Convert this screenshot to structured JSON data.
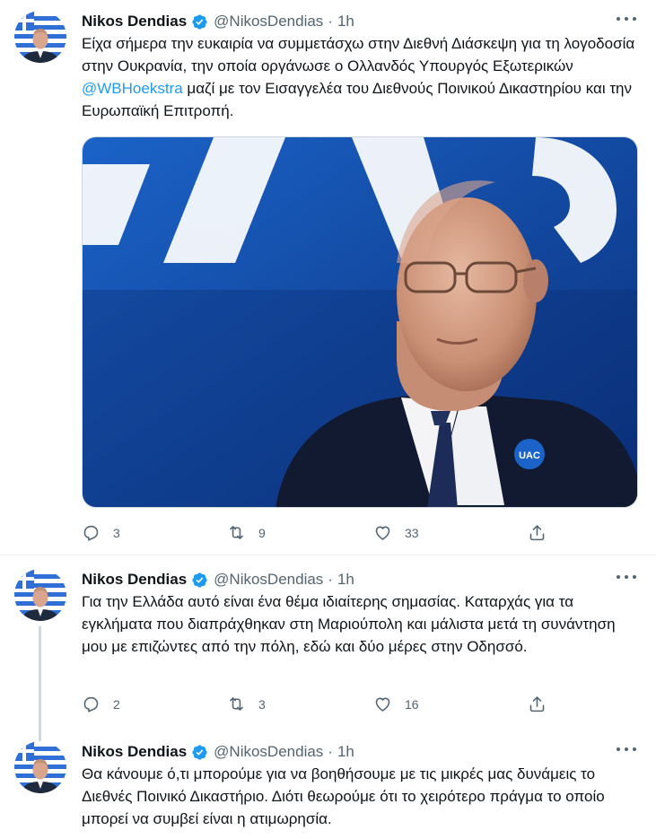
{
  "colors": {
    "accent": "#1d9bf0",
    "secondary": "#536471",
    "text": "#0f1419"
  },
  "tweets": [
    {
      "name": "Nikos Dendias",
      "handle": "@NikosDendias",
      "dot": "·",
      "time": "1h",
      "text_before": "Είχα σήμερα την ευκαιρία να συμμετάσχω στην Διεθνή Διάσκεψη για τη λογοδοσία στην Ουκρανία, την οποία οργάνωσε ο Ολλανδός Υπουργός Εξωτερικών ",
      "mention": "@WBHoekstra",
      "text_after": " μαζί με τον Εισαγγελέα του Διεθνούς Ποινικού Δικαστηρίου και την Ευρωπαϊκή Επιτροπή.",
      "media_badge": "UAC",
      "replies": "3",
      "retweets": "9",
      "likes": "33"
    },
    {
      "name": "Nikos Dendias",
      "handle": "@NikosDendias",
      "dot": "·",
      "time": "1h",
      "text": "Για την Ελλάδα αυτό είναι ένα θέμα ιδιαίτερης σημασίας. Καταρχάς για τα εγκλήματα που διαπράχθηκαν στη Μαριούπολη και μάλιστα μετά τη συνάντηση μου με επιζώντες από την πόλη, εδώ και δύο μέρες στην Οδησσό.",
      "replies": "2",
      "retweets": "3",
      "likes": "16"
    },
    {
      "name": "Nikos Dendias",
      "handle": "@NikosDendias",
      "dot": "·",
      "time": "1h",
      "text": "Θα κάνουμε ό,τι μπορούμε για να βοηθήσουμε με τις μικρές μας δυνάμεις το Διεθνές Ποινικό Δικαστήριο. Διότι θεωρούμε ότι το χειρότερο πράγμα το οποίο μπορεί να συμβεί είναι η ατιμωρησία."
    }
  ]
}
